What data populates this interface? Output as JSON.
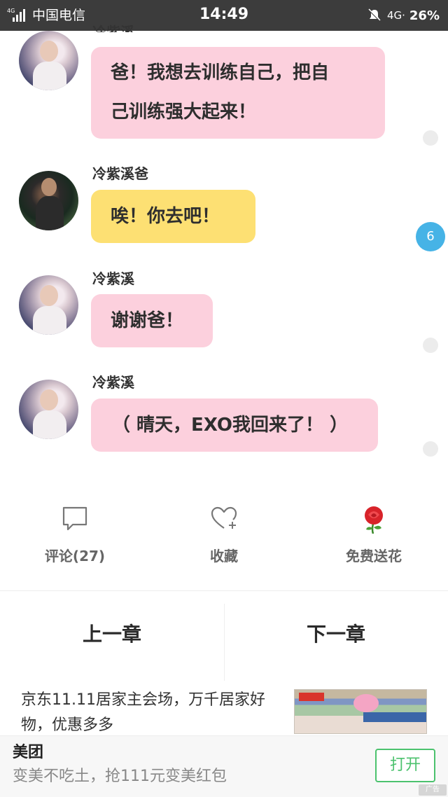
{
  "status_bar": {
    "network_small": "4G",
    "carrier": "中国电信",
    "time": "14:49",
    "network": "4G·",
    "battery": "26%"
  },
  "messages": [
    {
      "speaker": "冷紫溪",
      "bubble_color": "#fcd0dd",
      "lines": [
        "爸！我想去训练自己，把自",
        "己训练强大起来！"
      ]
    },
    {
      "speaker": "冷紫溪爸",
      "bubble_color": "#fde073",
      "lines": [
        "唉！你去吧！"
      ]
    },
    {
      "speaker": "冷紫溪",
      "bubble_color": "#fcd0dd",
      "lines": [
        "谢谢爸！"
      ]
    },
    {
      "speaker": "冷紫溪",
      "bubble_color": "#fcd0dd",
      "lines": [
        "（ 晴天，EXO我回来了！ ）"
      ]
    }
  ],
  "unread_badge": "6",
  "actions": {
    "comment_label": "评论(27)",
    "favorite_label": "收藏",
    "flower_label": "免费送花"
  },
  "chapter_nav": {
    "prev": "上一章",
    "next": "下一章"
  },
  "ad": {
    "text": "京东11.11居家主会场，万千居家好物，优惠多多"
  },
  "banner": {
    "title": "美团",
    "subtitle": "变美不吃土，抢111元变美红包",
    "button": "打开",
    "ad_tag": "广告"
  },
  "colors": {
    "pink_bubble": "#fcd0dd",
    "yellow_bubble": "#fde073",
    "badge_blue": "#46b3e6",
    "open_button_green": "#4cc26e"
  }
}
